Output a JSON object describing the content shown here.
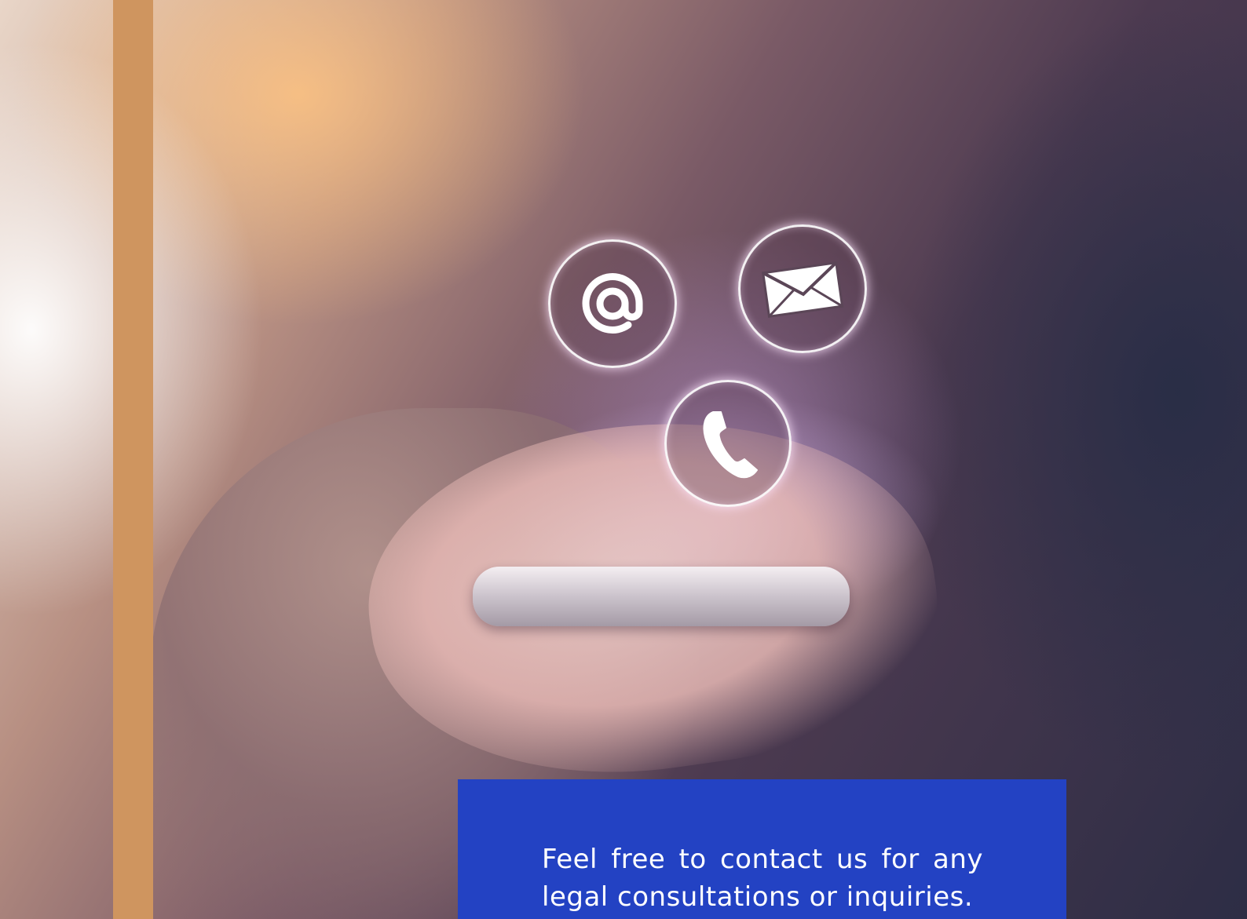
{
  "hero": {
    "icons": [
      "at-sign-icon",
      "envelope-icon",
      "phone-handset-icon"
    ]
  },
  "contact_box": {
    "text": "Feel free to contact us for any legal consultations or inquiries.",
    "background_color": "#2342c3",
    "text_color": "#ffffff"
  },
  "accent": {
    "stripe_color": "#cf955f"
  }
}
